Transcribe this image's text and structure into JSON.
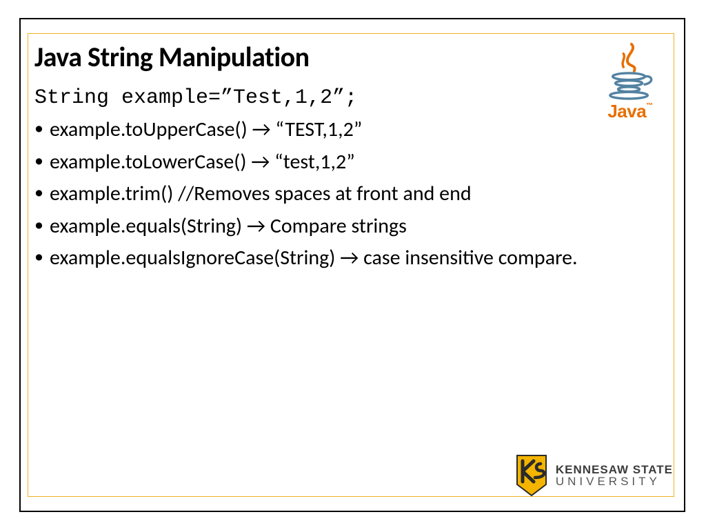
{
  "slide": {
    "title": "Java String Manipulation",
    "code_declaration": "String example=”Test,1,2”;",
    "bullets": [
      "example.toUpperCase()   → “TEST,1,2”",
      "example.toLowerCase()   → “test,1,2”",
      "example.trim()  //Removes spaces at front and end",
      "example.equals(String) → Compare strings",
      "example.equalsIgnoreCase(String) → case insensitive compare."
    ]
  },
  "logos": {
    "java": {
      "label": "Java"
    },
    "footer": {
      "line1": "KENNESAW STATE",
      "line2": "UNIVERSITY"
    }
  }
}
